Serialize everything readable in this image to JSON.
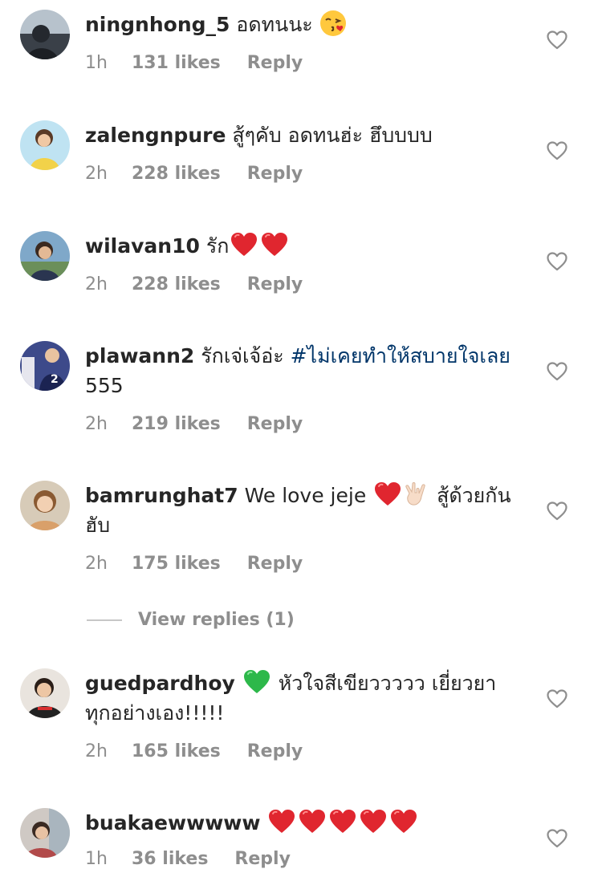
{
  "comments": [
    {
      "username": "ningnhong_5",
      "text": "อดทนนะ",
      "time": "1h",
      "likes": "131 likes",
      "reply": "Reply"
    },
    {
      "username": "zalengnpure",
      "text": "สู้ๆคับ อดทนฮ่ะ ฮึบบบบ",
      "time": "2h",
      "likes": "228 likes",
      "reply": "Reply"
    },
    {
      "username": "wilavan10",
      "text": "รัก",
      "time": "2h",
      "likes": "228 likes",
      "reply": "Reply"
    },
    {
      "username": "plawann2",
      "text": "รักเจ่เจ้อ่ะ",
      "hashtag": "#ไม่เคยทำให้สบายใจเลย",
      "text_after": "555",
      "time": "2h",
      "likes": "219 likes",
      "reply": "Reply"
    },
    {
      "username": "bamrunghat7",
      "text": "We love jeje",
      "text_after": "สู้ด้วยกันฮับ",
      "time": "2h",
      "likes": "175 likes",
      "reply": "Reply"
    },
    {
      "username": "guedpardhoy",
      "text": "หัวใจสีเขียววววว  เยี่ยวยาทุกอย่างเอง!!!!!",
      "time": "2h",
      "likes": "165 likes",
      "reply": "Reply"
    },
    {
      "username": "buakaewwwww",
      "text": "",
      "time": "1h",
      "likes": "36 likes",
      "reply": "Reply"
    }
  ],
  "view_replies": "View replies (1)",
  "icons": {
    "like": "heart-outline-icon",
    "red_heart": "red-heart-emoji",
    "green_heart": "green-heart-emoji",
    "kiss_face": "face-blowing-kiss-emoji",
    "love_you_hand": "love-you-gesture-emoji"
  },
  "colors": {
    "text": "#262626",
    "meta": "#8e8e8e",
    "hashtag": "#003569",
    "red_heart": "#e0262f",
    "green_heart": "#2db84a"
  }
}
